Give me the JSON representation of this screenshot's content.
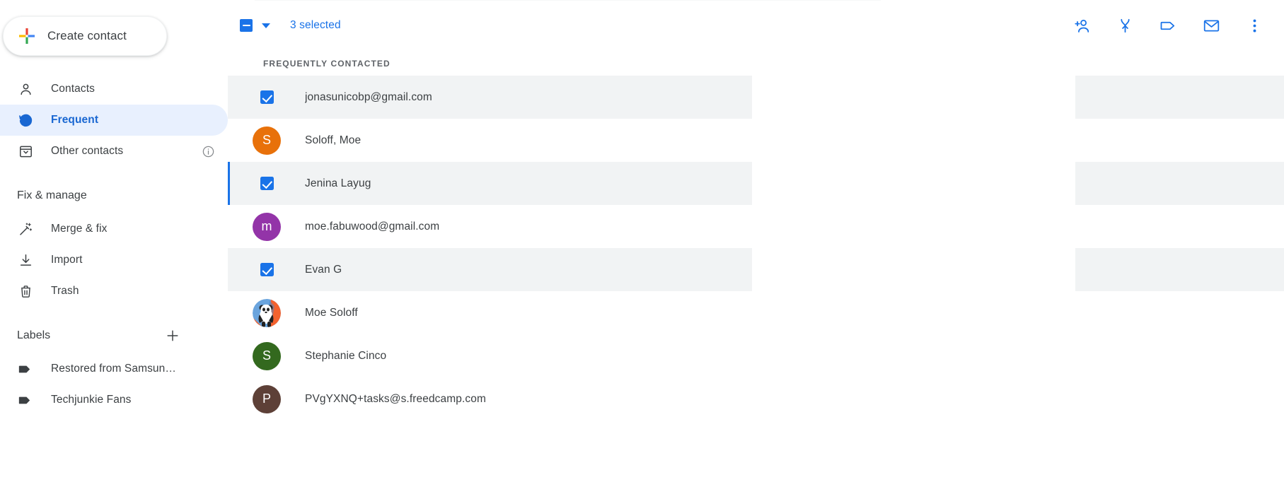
{
  "sidebar": {
    "create_button": {
      "label": "Create contact",
      "icon": "plus-icon"
    },
    "nav": [
      {
        "label": "Contacts",
        "icon": "person-icon",
        "active": false
      },
      {
        "label": "Frequent",
        "icon": "history-clock-icon",
        "active": true
      },
      {
        "label": "Other contacts",
        "icon": "archive-box-icon",
        "active": false,
        "trailing_icon": "info-icon"
      }
    ],
    "fix_manage_heading": "Fix & manage",
    "fix_manage": [
      {
        "label": "Merge & fix",
        "icon": "magic-wand-icon"
      },
      {
        "label": "Import",
        "icon": "download-icon"
      },
      {
        "label": "Trash",
        "icon": "trash-icon"
      }
    ],
    "labels_heading": "Labels",
    "labels_add_icon": "plus-add-icon",
    "labels": [
      {
        "label": "Restored from Samsun…",
        "icon": "label-tag-icon"
      },
      {
        "label": "Techjunkie Fans",
        "icon": "label-tag-icon"
      }
    ]
  },
  "toolbar": {
    "select_all_checkbox_state": "indeterminate",
    "dropdown_icon": "caret-down-icon",
    "selection_text": "3 selected",
    "actions": [
      {
        "name": "add-to-contacts-icon",
        "title": "Add to contacts"
      },
      {
        "name": "merge-icon",
        "title": "Merge"
      },
      {
        "name": "manage-labels-icon",
        "title": "Manage labels"
      },
      {
        "name": "send-email-icon",
        "title": "Send email"
      },
      {
        "name": "more-options-icon",
        "title": "More actions"
      }
    ]
  },
  "list": {
    "group_title": "FREQUENTLY CONTACTED",
    "rows": [
      {
        "name": "jonasunicobp@gmail.com",
        "selected": true,
        "focused": false,
        "avatar": {
          "type": "checkbox"
        }
      },
      {
        "name": "Soloff, Moe",
        "selected": false,
        "focused": false,
        "avatar": {
          "type": "initial",
          "initial": "S",
          "color": "#e8710a"
        }
      },
      {
        "name": "Jenina Layug",
        "selected": true,
        "focused": true,
        "avatar": {
          "type": "checkbox"
        }
      },
      {
        "name": "moe.fabuwood@gmail.com",
        "selected": false,
        "focused": false,
        "avatar": {
          "type": "initial",
          "initial": "m",
          "color": "#9334a8"
        }
      },
      {
        "name": "Evan G",
        "selected": true,
        "focused": false,
        "avatar": {
          "type": "checkbox"
        }
      },
      {
        "name": "Moe Soloff",
        "selected": false,
        "focused": false,
        "avatar": {
          "type": "photo",
          "description": "panda-photo",
          "color": "#5b9bd5"
        }
      },
      {
        "name": "Stephanie Cinco",
        "selected": false,
        "focused": false,
        "avatar": {
          "type": "initial",
          "initial": "S",
          "color": "#33691e"
        }
      },
      {
        "name": "PVgYXNQ+tasks@s.freedcamp.com",
        "selected": false,
        "focused": false,
        "avatar": {
          "type": "initial",
          "initial": "P",
          "color": "#5d4037"
        }
      }
    ]
  },
  "colors": {
    "accent_blue": "#1a73e8",
    "active_nav_bg": "#e8f0fe",
    "active_nav_text": "#1967d2",
    "row_selected_bg": "#f1f3f4",
    "text_primary": "#3c4043",
    "text_secondary": "#5f6368"
  }
}
